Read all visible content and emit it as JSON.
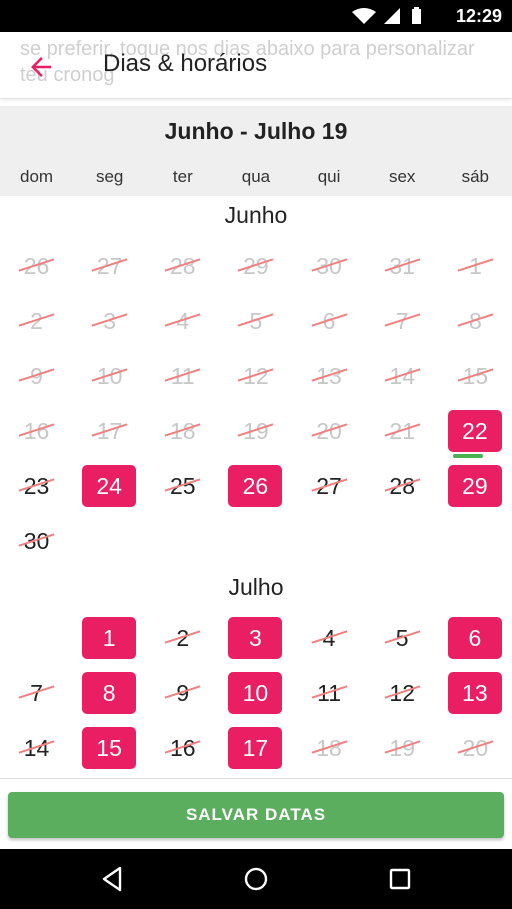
{
  "statusbar": {
    "time": "12:29"
  },
  "appbar": {
    "title": "Dias & horários",
    "behind_text": "se preferir, toque nos dias abaixo para personalizar teu cronog"
  },
  "header": {
    "range": "Junho - Julho  19"
  },
  "weekdays": [
    "dom",
    "seg",
    "ter",
    "qua",
    "qui",
    "sex",
    "sáb"
  ],
  "months": [
    {
      "title": "Junho",
      "weeks": [
        [
          {
            "d": "26",
            "s": "disabled"
          },
          {
            "d": "27",
            "s": "disabled"
          },
          {
            "d": "28",
            "s": "disabled"
          },
          {
            "d": "29",
            "s": "disabled"
          },
          {
            "d": "30",
            "s": "disabled"
          },
          {
            "d": "31",
            "s": "disabled"
          },
          {
            "d": "1",
            "s": "disabled"
          }
        ],
        [
          {
            "d": "2",
            "s": "disabled"
          },
          {
            "d": "3",
            "s": "disabled"
          },
          {
            "d": "4",
            "s": "disabled"
          },
          {
            "d": "5",
            "s": "disabled"
          },
          {
            "d": "6",
            "s": "disabled"
          },
          {
            "d": "7",
            "s": "disabled"
          },
          {
            "d": "8",
            "s": "disabled"
          }
        ],
        [
          {
            "d": "9",
            "s": "disabled"
          },
          {
            "d": "10",
            "s": "disabled"
          },
          {
            "d": "11",
            "s": "disabled"
          },
          {
            "d": "12",
            "s": "disabled"
          },
          {
            "d": "13",
            "s": "disabled"
          },
          {
            "d": "14",
            "s": "disabled"
          },
          {
            "d": "15",
            "s": "disabled"
          }
        ],
        [
          {
            "d": "16",
            "s": "disabled"
          },
          {
            "d": "17",
            "s": "disabled"
          },
          {
            "d": "18",
            "s": "disabled"
          },
          {
            "d": "19",
            "s": "disabled"
          },
          {
            "d": "20",
            "s": "disabled"
          },
          {
            "d": "21",
            "s": "disabled"
          },
          {
            "d": "22",
            "s": "available",
            "today": true
          }
        ],
        [
          {
            "d": "23",
            "s": "unavailable"
          },
          {
            "d": "24",
            "s": "available"
          },
          {
            "d": "25",
            "s": "unavailable"
          },
          {
            "d": "26",
            "s": "available"
          },
          {
            "d": "27",
            "s": "unavailable"
          },
          {
            "d": "28",
            "s": "unavailable"
          },
          {
            "d": "29",
            "s": "available"
          }
        ],
        [
          {
            "d": "30",
            "s": "unavailable"
          },
          null,
          null,
          null,
          null,
          null,
          null
        ]
      ]
    },
    {
      "title": "Julho",
      "weeks": [
        [
          null,
          {
            "d": "1",
            "s": "available"
          },
          {
            "d": "2",
            "s": "unavailable"
          },
          {
            "d": "3",
            "s": "available"
          },
          {
            "d": "4",
            "s": "unavailable"
          },
          {
            "d": "5",
            "s": "unavailable"
          },
          {
            "d": "6",
            "s": "available"
          }
        ],
        [
          {
            "d": "7",
            "s": "unavailable"
          },
          {
            "d": "8",
            "s": "available"
          },
          {
            "d": "9",
            "s": "unavailable"
          },
          {
            "d": "10",
            "s": "available"
          },
          {
            "d": "11",
            "s": "unavailable"
          },
          {
            "d": "12",
            "s": "unavailable"
          },
          {
            "d": "13",
            "s": "available"
          }
        ],
        [
          {
            "d": "14",
            "s": "unavailable"
          },
          {
            "d": "15",
            "s": "available"
          },
          {
            "d": "16",
            "s": "unavailable"
          },
          {
            "d": "17",
            "s": "available"
          },
          {
            "d": "18",
            "s": "disabled"
          },
          {
            "d": "19",
            "s": "disabled"
          },
          {
            "d": "20",
            "s": "disabled"
          }
        ]
      ]
    }
  ],
  "save_button": {
    "label": "SALVAR DATAS"
  },
  "colors": {
    "accent": "#e91e63",
    "save": "#5cae5f",
    "strike": "#f08080",
    "today_indicator": "#4caf50"
  }
}
